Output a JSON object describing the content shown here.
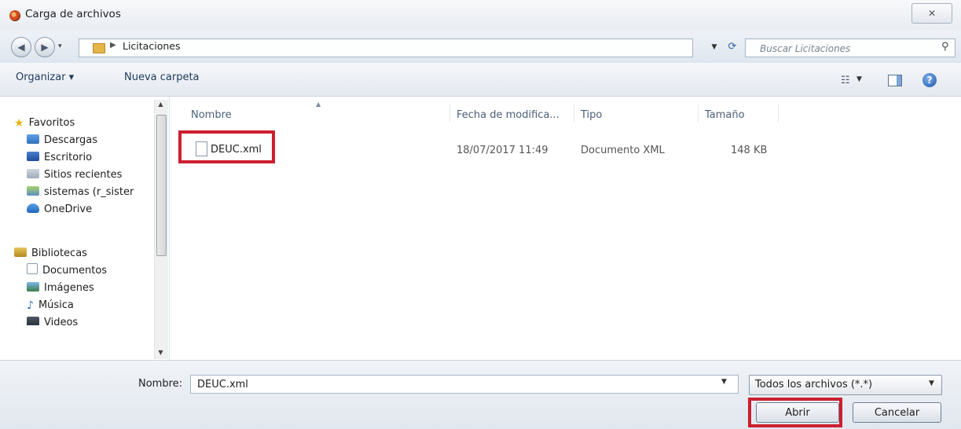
{
  "window": {
    "title": "Carga de archivos",
    "close_glyph": "✕"
  },
  "address_bar": {
    "path": "Licitaciones",
    "search_placeholder": "Buscar Licitaciones"
  },
  "toolbar": {
    "organize_label": "Organizar ▾",
    "new_folder_label": "Nueva carpeta"
  },
  "nav": {
    "favorites": [
      {
        "label": "Favoritos",
        "icon": "star-icon"
      },
      {
        "label": "Descargas",
        "icon": "downloads-folder-icon"
      },
      {
        "label": "Escritorio",
        "icon": "desktop-icon"
      },
      {
        "label": "Sitios recientes",
        "icon": "recent-places-icon"
      },
      {
        "label": "sistemas (r_sister",
        "icon": "network-drive-icon"
      },
      {
        "label": "OneDrive",
        "icon": "cloud-icon"
      }
    ],
    "libraries": [
      {
        "label": "Bibliotecas",
        "icon": "libraries-icon"
      },
      {
        "label": "Documentos",
        "icon": "documents-icon"
      },
      {
        "label": "Imágenes",
        "icon": "pictures-icon"
      },
      {
        "label": "Música",
        "icon": "music-icon"
      },
      {
        "label": "Videos",
        "icon": "videos-icon"
      }
    ]
  },
  "file_list": {
    "columns": [
      "Nombre",
      "Fecha de modifica...",
      "Tipo",
      "Tamaño"
    ],
    "files": [
      {
        "name": "DEUC.xml",
        "modified": "18/07/2017 11:49",
        "type": "Documento XML",
        "size": "148 KB"
      }
    ]
  },
  "bottom": {
    "name_label": "Nombre:",
    "name_value": "DEUC.xml",
    "filter_value": "Todos los archivos (*.*)",
    "open_label": "Abrir",
    "cancel_label": "Cancelar"
  },
  "highlight_color": "#cc1f2f"
}
